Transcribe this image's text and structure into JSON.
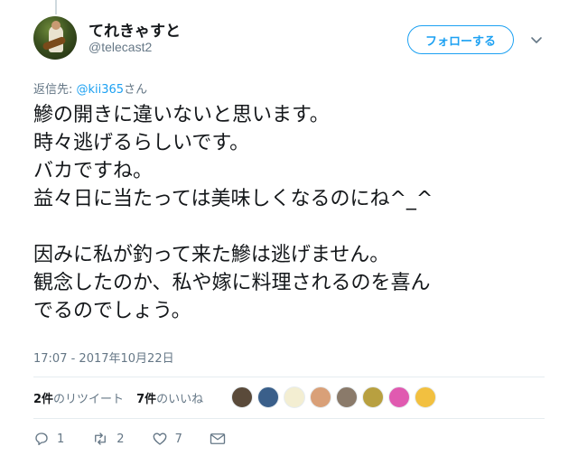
{
  "author": {
    "display_name": "てれきゃすと",
    "handle": "@telecast2"
  },
  "follow_button": {
    "label": "フォローする"
  },
  "reply_to": {
    "prefix": "返信先: ",
    "mention": "@kii365",
    "suffix": "さん"
  },
  "tweet": {
    "text": "鰺の開きに違いないと思います。\n時々逃げるらしいです。\nバカですね。\n益々日に当たっては美味しくなるのにね^_^\n\n因みに私が釣って来た鰺は逃げません。\n観念したのか、私や嫁に料理されるのを喜ん\nでるのでしょう。",
    "timestamp": "17:07 - 2017年10月22日"
  },
  "stats": {
    "retweets_count": "2件",
    "retweets_label": "のリツイート",
    "likes_count": "7件",
    "likes_label": "のいいね"
  },
  "liker_avatars": [
    {
      "color": "#5a4a3a"
    },
    {
      "color": "#3a5f8a"
    },
    {
      "color": "#f3eed2"
    },
    {
      "color": "#d9a078"
    },
    {
      "color": "#8a7a6a"
    },
    {
      "color": "#b8a040"
    },
    {
      "color": "#e05ab0"
    },
    {
      "color": "#f2c040"
    }
  ],
  "actions": {
    "reply_count": "1",
    "retweet_count": "2",
    "like_count": "7"
  },
  "colors": {
    "accent": "#1da1f2",
    "secondary_text": "#657786",
    "divider": "#e6ecf0"
  }
}
